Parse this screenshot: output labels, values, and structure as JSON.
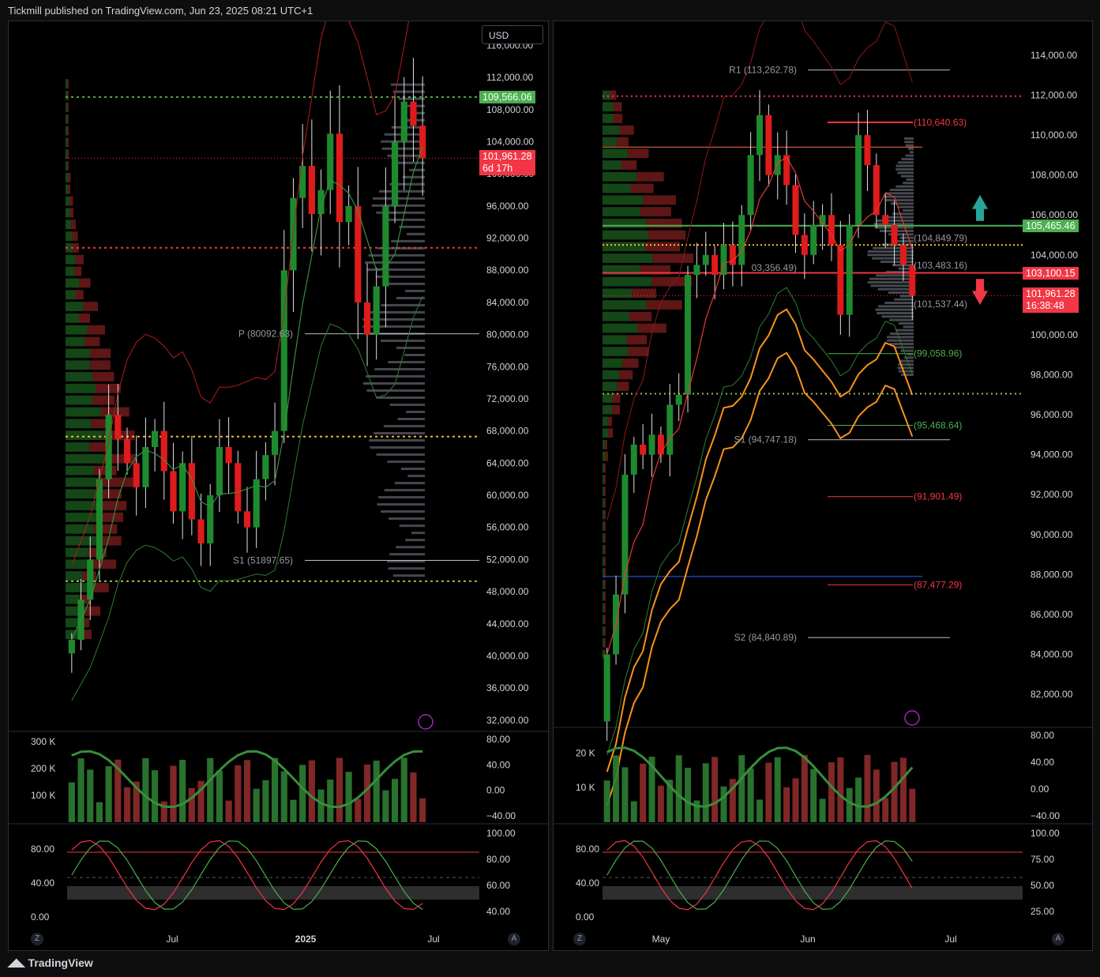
{
  "header": {
    "published": "Tickmill published on TradingView.com, Jun 23, 2025 08:21 UTC+1"
  },
  "footer": {
    "brand": "TradingView",
    "logo": "tv-logo-icon"
  },
  "left": {
    "currency_button": "USD",
    "price_ticks": [
      "116,000.00",
      "112,000.00",
      "108,000.00",
      "104,000.00",
      "100,000.00",
      "96,000.00",
      "92,000.00",
      "88,000.00",
      "84,000.00",
      "80,000.00",
      "76,000.00",
      "72,000.00",
      "68,000.00",
      "64,000.00",
      "60,000.00",
      "56,000.00",
      "52,000.00",
      "48,000.00",
      "44,000.00",
      "40,000.00",
      "36,000.00",
      "32,000.00"
    ],
    "price_range": [
      31000,
      118500
    ],
    "last_price_tag": {
      "value": "101,961.28",
      "sub": "6d 17h",
      "price": 101961.28
    },
    "level_tag": {
      "value": "109,566.06",
      "price": 109566.06
    },
    "pivot_labels": [
      {
        "text": "P (80092.63)",
        "price": 80092.63
      },
      {
        "text": "S1 (51897.65)",
        "price": 51897.65
      }
    ],
    "time_ticks": [
      "Jul",
      "2025",
      "Jul"
    ],
    "volume_ticks": [
      "300 K",
      "200 K",
      "100 K"
    ],
    "volume_right_ticks": [
      "80.00",
      "40.00",
      "0.00",
      "−40.00"
    ],
    "osc_left_ticks": [
      "80.00",
      "40.00",
      "0.00"
    ],
    "osc_right_ticks": [
      "100.00",
      "80.00",
      "60.00",
      "40.00"
    ],
    "corner_left": "Z",
    "corner_right": "A"
  },
  "right": {
    "price_ticks": [
      "114,000.00",
      "112,000.00",
      "110,000.00",
      "108,000.00",
      "106,000.00",
      "104,000.00",
      "102,000.00",
      "100,000.00",
      "98,000.00",
      "96,000.00",
      "94,000.00",
      "92,000.00",
      "90,000.00",
      "88,000.00",
      "86,000.00",
      "84,000.00",
      "82,000.00"
    ],
    "price_range": [
      80500,
      115500
    ],
    "last_price_tag": {
      "value": "101,961.28",
      "sub": "16:38:48",
      "price": 101961.28
    },
    "green_tag": {
      "value": "105,465.46",
      "price": 105465.46
    },
    "red_tag": {
      "value": "103,100.15",
      "price": 103100.15
    },
    "pivot_labels": [
      {
        "text": "R1 (113,262.78)",
        "price": 113262.78
      },
      {
        "text": "(110,640.63)",
        "price": 110640.63
      },
      {
        "text": "(104,849.79)",
        "price": 104849.79
      },
      {
        "text": "03,356.49)",
        "price": 103356.49
      },
      {
        "text": "(103,483.16)",
        "price": 103483.16
      },
      {
        "text": "(101,537.44)",
        "price": 101537.44
      },
      {
        "text": "(99,058.96)",
        "price": 99058.96
      },
      {
        "text": "(95,468.64)",
        "price": 95468.64
      },
      {
        "text": "S1 (94,747.18)",
        "price": 94747.18
      },
      {
        "text": "(91,901.49)",
        "price": 91901.49
      },
      {
        "text": "(87,477.29)",
        "price": 87477.29
      },
      {
        "text": "S2 (84,840.89)",
        "price": 84840.89
      }
    ],
    "time_ticks": [
      "May",
      "Jun",
      "Jul"
    ],
    "volume_ticks": [
      "20 K",
      "10 K"
    ],
    "volume_right_ticks": [
      "80.00",
      "40.00",
      "0.00",
      "−40.00"
    ],
    "osc_left_ticks": [
      "80.00",
      "40.00",
      "0.00"
    ],
    "osc_right_ticks": [
      "100.00",
      "75.00",
      "50.00",
      "25.00"
    ],
    "corner_left": "Z",
    "corner_right": "A"
  },
  "colors": {
    "up": "#089981",
    "down": "#f23645",
    "bull_candle": "#1e8a2e",
    "bear_candle": "#e01b1b",
    "orange": "#f7931a",
    "green_level": "#4caf50",
    "red_level": "#f23645"
  },
  "chart_data": [
    {
      "type": "candlestick",
      "title": "",
      "timeframe": "weekly",
      "x_ticks": [
        "Jul",
        "2025",
        "Jul"
      ],
      "ylim": [
        31000,
        118500
      ],
      "approx_closes": [
        42000,
        47000,
        52000,
        62000,
        70000,
        67000,
        64000,
        61000,
        66000,
        68000,
        63000,
        58000,
        64000,
        57000,
        54000,
        60000,
        66000,
        64000,
        58000,
        56000,
        62000,
        65000,
        68000,
        88000,
        97000,
        101000,
        95000,
        98000,
        105000,
        94000,
        96000,
        84000,
        80000,
        86000,
        96000,
        104000,
        109000,
        106000,
        101961.28
      ],
      "indicators": [
        "volume",
        "stochastic RSI",
        "bollinger-style bands",
        "volume profile"
      ]
    },
    {
      "type": "candlestick",
      "title": "",
      "timeframe": "daily",
      "x_ticks": [
        "May",
        "Jun",
        "Jul"
      ],
      "ylim": [
        80500,
        115500
      ],
      "approx_closes": [
        84000,
        87000,
        93000,
        94500,
        94000,
        95000,
        94000,
        96500,
        97000,
        103000,
        103500,
        104000,
        103000,
        104500,
        103500,
        106000,
        109000,
        111000,
        108000,
        109000,
        107500,
        105000,
        104000,
        105500,
        106000,
        104500,
        101000,
        105500,
        110000,
        108500,
        106000,
        105500,
        104500,
        103500,
        101961.28
      ],
      "indicators": [
        "volume",
        "stochastic RSI",
        "moving averages",
        "volume profile"
      ]
    }
  ]
}
